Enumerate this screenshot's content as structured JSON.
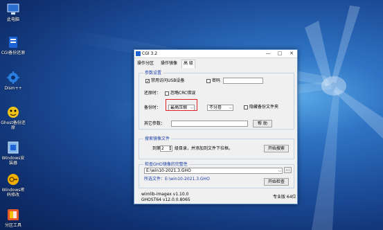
{
  "desktop": {
    "icons": [
      {
        "label": "此电脑",
        "icon": "computer-icon",
        "color": "#9fc6ef"
      },
      {
        "label": "CGI备份还原",
        "icon": "cgi-backup-icon",
        "color": "#1e63d6"
      },
      {
        "label": "Dism++",
        "icon": "gear-icon",
        "color": "#2b7ee0"
      },
      {
        "label": "Ghost备份还原",
        "icon": "ghost-icon",
        "color": "#f1c21a"
      },
      {
        "label": "Windows安装器",
        "icon": "windows-installer-icon",
        "color": "#7fb4e6"
      },
      {
        "label": "Windows密码修改",
        "icon": "password-key-icon",
        "color": "#f0b000"
      },
      {
        "label": "分区工具",
        "icon": "partition-tool-icon",
        "color": "#e8572a"
      }
    ]
  },
  "window": {
    "title": "CGI 3.2",
    "controls": {
      "minimize": "—",
      "maximize": "□",
      "close": "✕"
    },
    "tabs": [
      "操作分区",
      "操作镜像",
      "高 级"
    ],
    "params": {
      "group_label": "参数设置",
      "disable_usb_label": "禁用访问USB设备",
      "disable_usb_checked": "✓",
      "password_label": "密码",
      "password_value": "",
      "restore_label": "还原时：",
      "ignore_crc_label": "忽略CRC错误",
      "backup_label": "备份时：",
      "compression_value": "最高压缩",
      "split_value": "不分卷",
      "hide_backup_label": "隐藏备份文件夹",
      "other_params_label": "其它参数：",
      "other_params_value": "",
      "help_button": "帮 助"
    },
    "search": {
      "group_label": "搜索镜像文件",
      "depth_prefix": "到第",
      "depth_value": "2",
      "depth_suffix": "级目录，并添加到文件下拉框。",
      "start_search_button": "开始搜索"
    },
    "check": {
      "group_label": "检查GHO镜像的完整性",
      "path_value": "E:\\win10-2021.3.GHO",
      "browse_button": "...",
      "selected_label": "所选文件：E:\\win10-2021.3.GHO",
      "start_check_button": "开始检查"
    },
    "footer": {
      "wimlib": "wimlib-imagex v1.10.0",
      "ghost": "GHOST64 v12.0.0.8065",
      "edition": "专业版 64位"
    }
  },
  "colors": {
    "accent": "#1a3fa8",
    "annotation": "#e02020"
  }
}
